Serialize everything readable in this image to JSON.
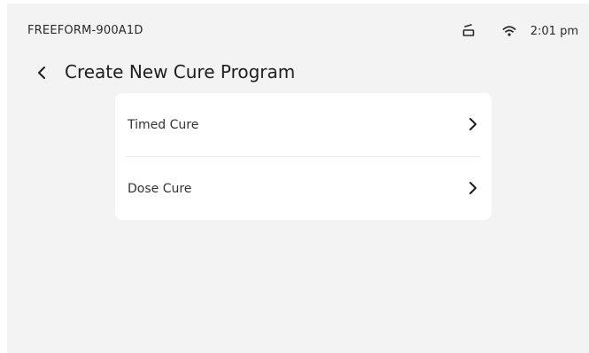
{
  "status_bar": {
    "device_name": "FREEFORM-900A1D",
    "lamp_icon": "lamp-icon",
    "wifi_icon": "wifi-icon",
    "time": "2:01 pm"
  },
  "header": {
    "back_icon": "chevron-left-icon",
    "title": "Create New Cure Program"
  },
  "menu": {
    "items": [
      {
        "label": "Timed Cure",
        "icon": "chevron-right-icon"
      },
      {
        "label": "Dose Cure",
        "icon": "chevron-right-icon"
      }
    ]
  },
  "colors": {
    "background": "#f3f3f3",
    "card": "#ffffff",
    "text": "#1e1e1e",
    "divider": "#ececec"
  }
}
